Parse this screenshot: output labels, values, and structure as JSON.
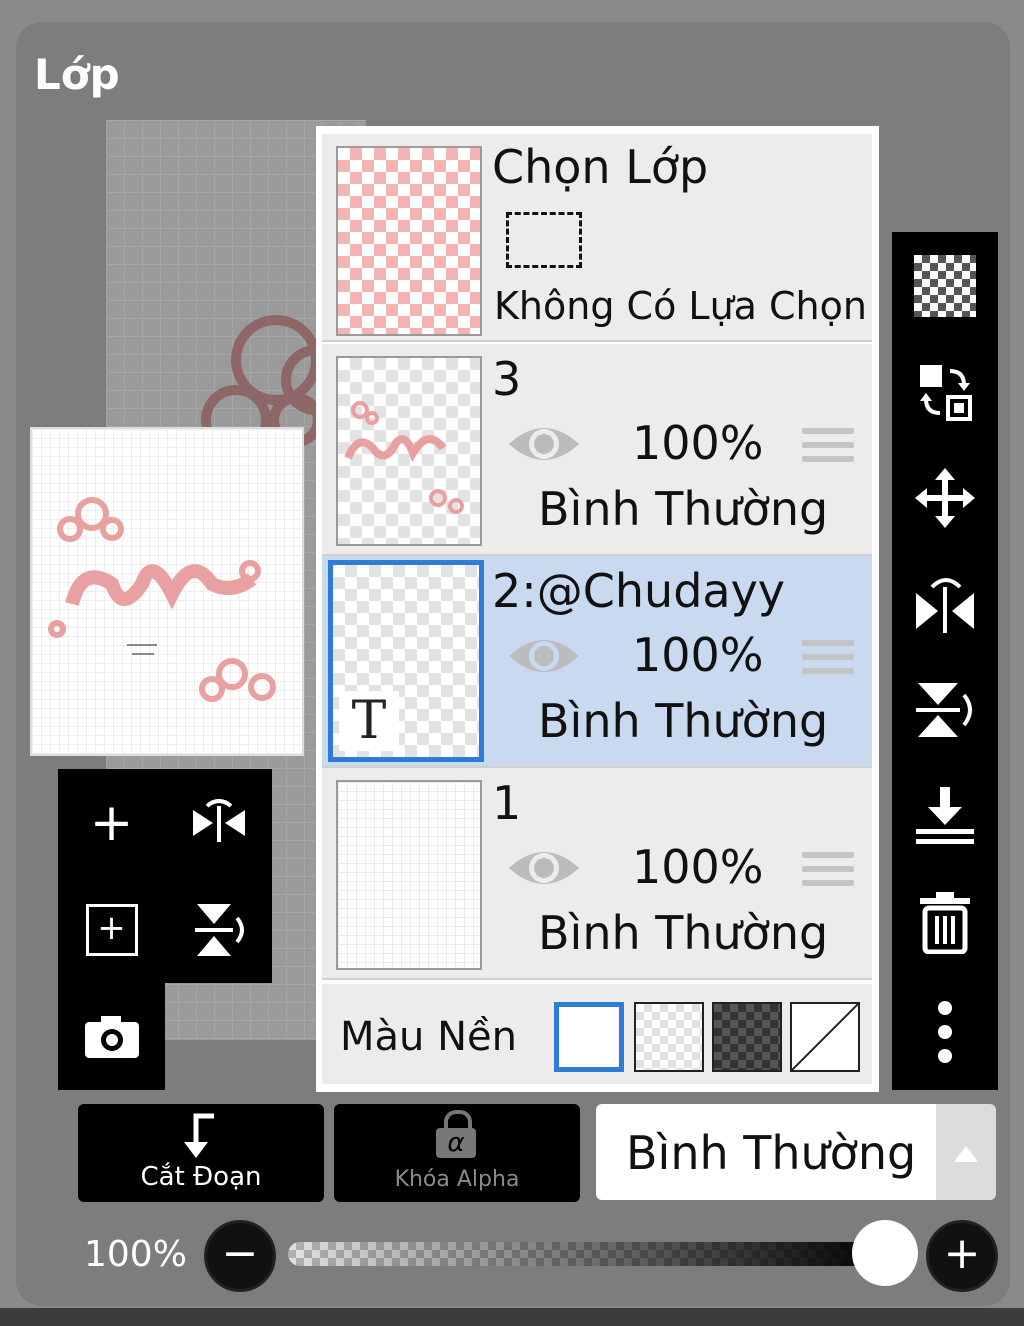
{
  "panel": {
    "title": "Lớp"
  },
  "layers": {
    "selection_layer": {
      "name": "Chọn Lớp",
      "status": "Không Có Lựa Chọn"
    },
    "items": [
      {
        "name": "3",
        "opacity": "100%",
        "blend": "Bình Thường",
        "selected": false
      },
      {
        "name": "2:@Chudayy",
        "opacity": "100%",
        "blend": "Bình Thường",
        "selected": true,
        "type_badge": "T"
      },
      {
        "name": "1",
        "opacity": "100%",
        "blend": "Bình Thường",
        "selected": false
      }
    ],
    "background": {
      "label": "Màu Nền",
      "options": [
        "white",
        "transparent",
        "dark-checker",
        "none"
      ],
      "selected": "white"
    }
  },
  "buttons": {
    "clipping": "Cắt Đoạn",
    "alpha_lock": "Khóa Alpha",
    "alpha_symbol": "α",
    "blend_mode": "Bình Thường"
  },
  "opacity": {
    "value": "100%",
    "minus": "−",
    "plus": "+",
    "slider_level": 1.0
  },
  "mini_tools": {
    "add": "+",
    "add_copy": "+"
  },
  "colors": {
    "selected_row": "#c9d9ef",
    "accent": "#2f7bd8"
  }
}
